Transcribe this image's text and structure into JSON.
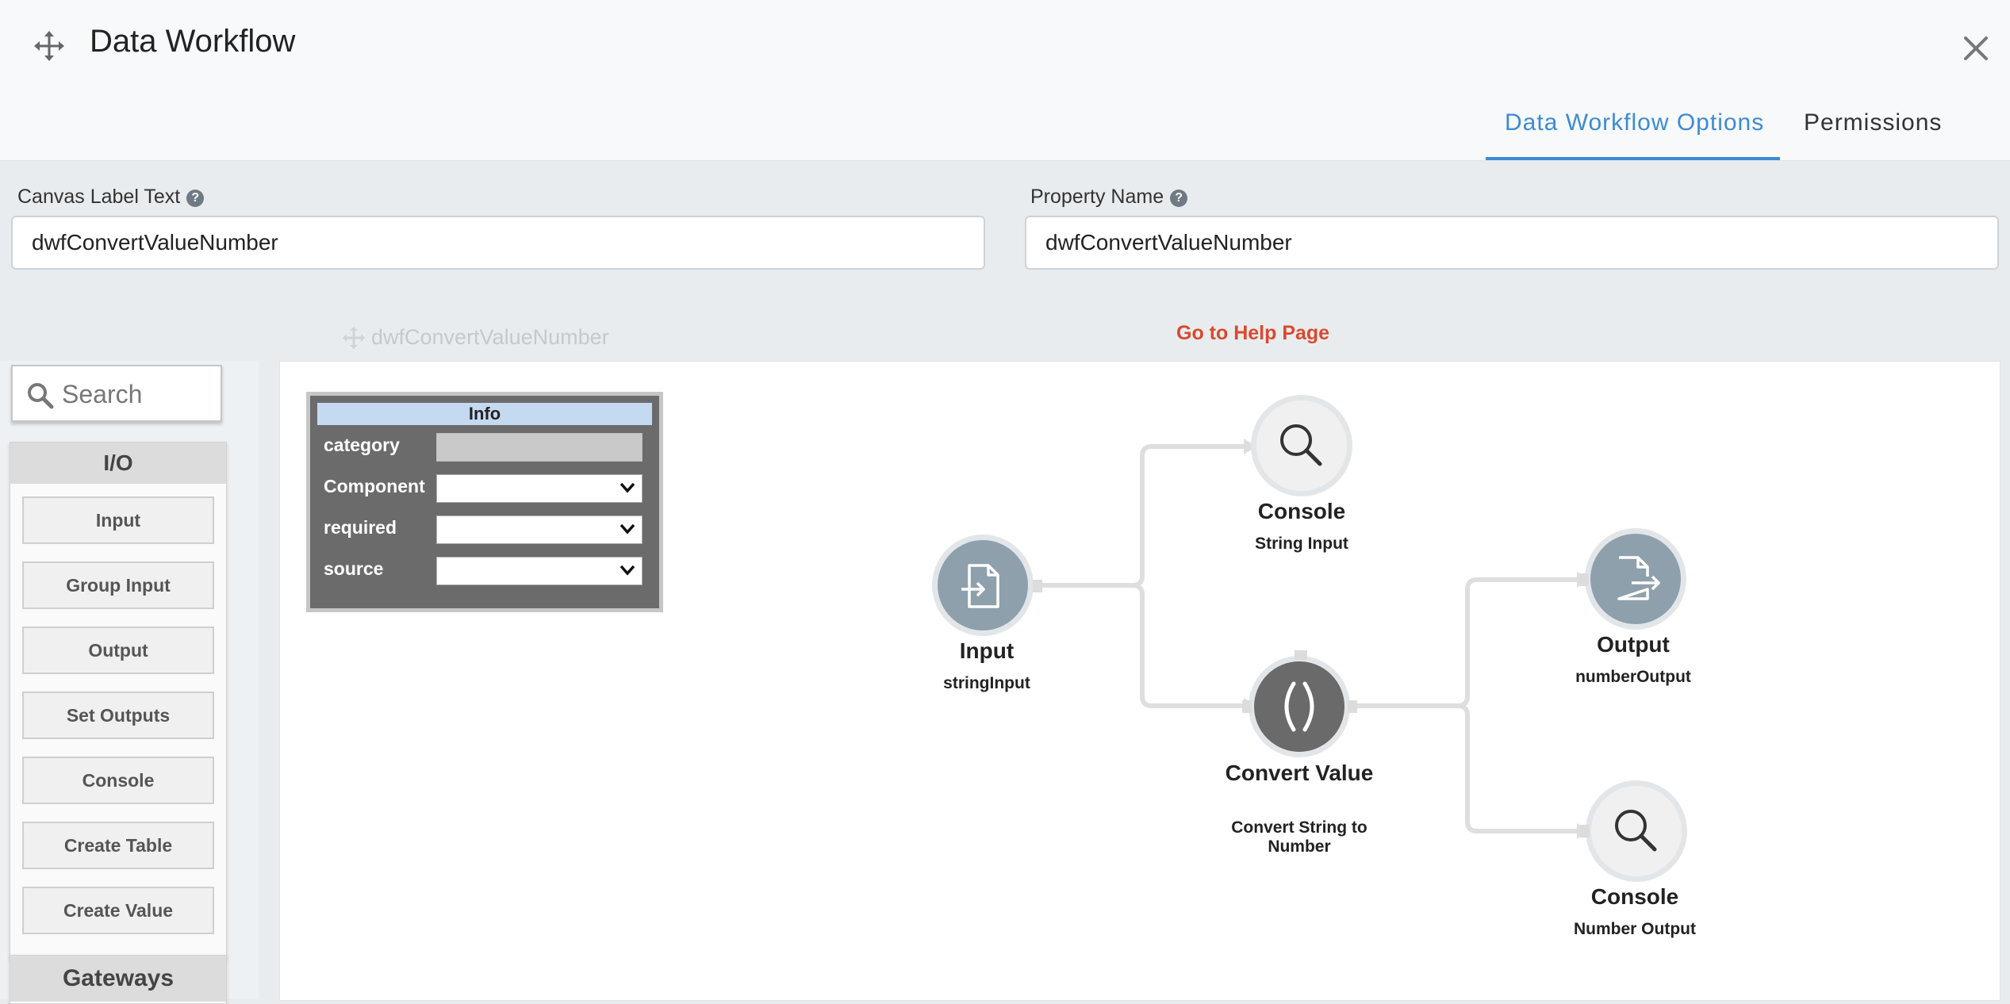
{
  "header": {
    "title": "Data Workflow",
    "tabs": [
      {
        "label": "Data Workflow Options",
        "active": true
      },
      {
        "label": "Permissions",
        "active": false
      }
    ]
  },
  "form": {
    "canvas_label": {
      "label": "Canvas Label Text",
      "value": "dwfConvertValueNumber"
    },
    "property_name": {
      "label": "Property Name",
      "value": "dwfConvertValueNumber"
    }
  },
  "canvas_ghost_label": "dwfConvertValueNumber",
  "help_link": "Go to Help Page",
  "palette": {
    "search_placeholder": "Search",
    "io": {
      "header": "I/O",
      "items": [
        "Input",
        "Group Input",
        "Output",
        "Set Outputs",
        "Console",
        "Create Table",
        "Create Value"
      ]
    },
    "gateways_header": "Gateways"
  },
  "info_panel": {
    "title": "Info",
    "rows": [
      {
        "key": "category",
        "value": ""
      },
      {
        "key": "Component",
        "value": ""
      },
      {
        "key": "required",
        "value": ""
      },
      {
        "key": "source",
        "value": ""
      }
    ]
  },
  "nodes": {
    "input": {
      "title": "Input",
      "subtitle": "stringInput",
      "icon": "file-import-icon"
    },
    "console_string": {
      "title": "Console",
      "subtitle": "String Input",
      "icon": "magnifier-icon"
    },
    "convert": {
      "title": "Convert Value",
      "subtitle": "Convert String to Number",
      "icon": "parentheses-icon"
    },
    "output": {
      "title": "Output",
      "subtitle": "numberOutput",
      "icon": "file-export-icon"
    },
    "console_number": {
      "title": "Console",
      "subtitle": "Number Output",
      "icon": "magnifier-icon"
    }
  },
  "colors": {
    "accent": "#3d8bd3",
    "help_link": "#d9492f",
    "node_gray": "#8fa0ad",
    "node_dark": "#6a6a6a",
    "info_header": "#c5d9f1"
  }
}
